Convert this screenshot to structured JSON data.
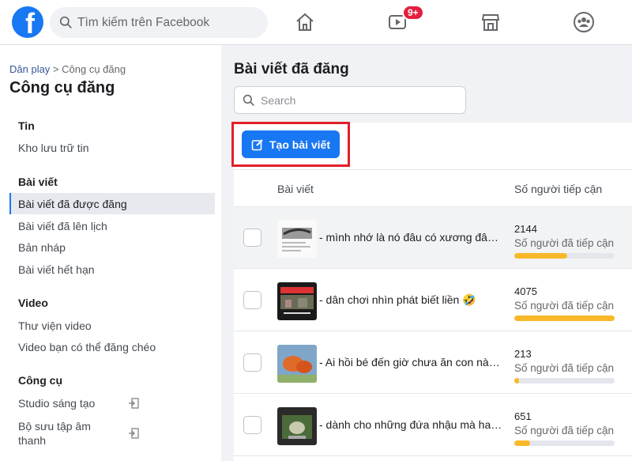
{
  "topbar": {
    "logo_letter": "f",
    "search_placeholder": "Tìm kiếm trên Facebook",
    "video_badge": "9+",
    "nav_icons": [
      "home-icon",
      "video-icon",
      "marketplace-icon",
      "groups-icon"
    ]
  },
  "sidebar": {
    "breadcrumb_link": "Dân play",
    "breadcrumb_sep": " > ",
    "breadcrumb_current": "Công cụ đăng",
    "title": "Công cụ đăng",
    "sections": {
      "tin": {
        "heading": "Tin",
        "items": [
          "Kho lưu trữ tin"
        ]
      },
      "baiviet": {
        "heading": "Bài viết",
        "items": [
          "Bài viết đã được đăng",
          "Bài viết đã lên lịch",
          "Bản nháp",
          "Bài viết hết hạn"
        ]
      },
      "video": {
        "heading": "Video",
        "items": [
          "Thư viện video",
          "Video bạn có thể đăng chéo"
        ]
      },
      "congcu": {
        "heading": "Công cụ",
        "items": [
          "Studio sáng tạo",
          "Bộ sưu tập âm thanh"
        ]
      }
    }
  },
  "main": {
    "title": "Bài viết đã đăng",
    "search_placeholder": "Search",
    "create_button": "Tạo bài viết",
    "columns": {
      "post": "Bài viết",
      "reach": "Số người tiếp cận"
    },
    "rows": [
      {
        "text": "- mình nhớ là nó đâu có xương đâu mà gãy được",
        "reach": "2144",
        "reach_label": "Số người đã tiếp cận",
        "reach_fraction": 0.53
      },
      {
        "text": "- dân chơi nhìn phát biết liền 🤣",
        "reach": "4075",
        "reach_label": "Số người đã tiếp cận",
        "reach_fraction": 1.0
      },
      {
        "text": "- Ai hồi bé đến giờ chưa ăn con này bao giờ",
        "reach": "213",
        "reach_label": "Số người đã tiếp cận",
        "reach_fraction": 0.05
      },
      {
        "text": "- dành cho những đứa nhậu mà hay quên",
        "reach": "651",
        "reach_label": "Số người đã tiếp cận",
        "reach_fraction": 0.16
      }
    ]
  },
  "colors": {
    "brand": "#1877f2",
    "highlight": "#e41e2a",
    "reach_bar": "#f7b928"
  }
}
